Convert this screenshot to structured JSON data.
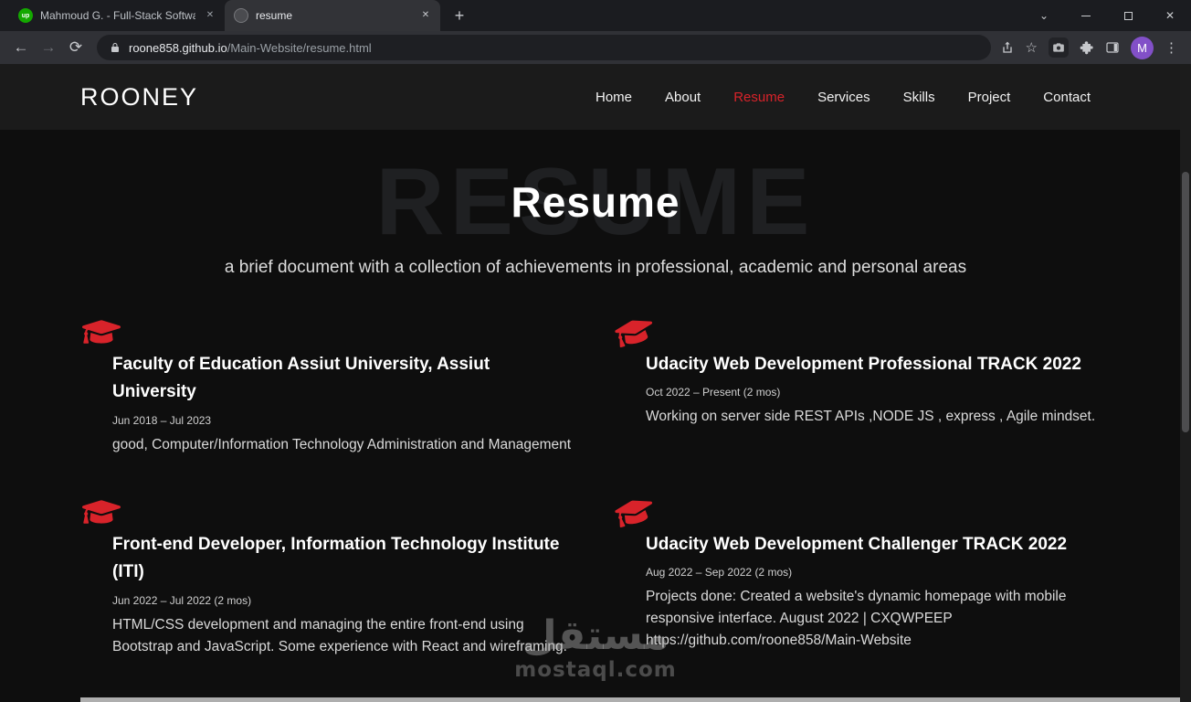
{
  "colors": {
    "accent-red": "#d8232a",
    "upwork-green": "#14a800",
    "avatar-purple": "#8250c8"
  },
  "browser": {
    "tabs": [
      {
        "title": "Mahmoud G. - Full-Stack Softwar",
        "favicon_text": "up"
      },
      {
        "title": "resume"
      }
    ],
    "url_host": "roone858.github.io",
    "url_path": "/Main-Website/resume.html",
    "avatar_letter": "M"
  },
  "icons": {
    "back": "←",
    "forward": "→",
    "reload": "⟳",
    "new_tab": "+",
    "tab_close": "✕",
    "window_chevron": "⌄",
    "window_close": "✕",
    "star": "☆",
    "kebab": "⋮"
  },
  "site": {
    "logo": "ROONEY",
    "nav": [
      {
        "label": "Home",
        "active": false
      },
      {
        "label": "About",
        "active": false
      },
      {
        "label": "Resume",
        "active": true
      },
      {
        "label": "Services",
        "active": false
      },
      {
        "label": "Skills",
        "active": false
      },
      {
        "label": "Project",
        "active": false
      },
      {
        "label": "Contact",
        "active": false
      }
    ]
  },
  "hero": {
    "bg_text": "RESUME",
    "title": "Resume",
    "subtitle": "a brief document with a collection of achievements in professional, academic and personal areas"
  },
  "resume_items": [
    {
      "title": "Faculty of Education Assiut University, Assiut University",
      "date": "Jun 2018 – Jul 2023",
      "description": "good, Computer/Information Technology Administration and Management"
    },
    {
      "title": "Udacity Web Development Professional TRACK 2022",
      "date": "Oct 2022 – Present (2 mos)",
      "description": "Working on server side REST APIs ,NODE JS , express , Agile mindset."
    },
    {
      "title": "Front-end Developer, Information Technology Institute (ITI)",
      "date": "Jun 2022 – Jul 2022 (2 mos)",
      "description": "HTML/CSS development and managing the entire front-end using Bootstrap and JavaScript. Some experience with React and wireframing."
    },
    {
      "title": "Udacity Web Development Challenger TRACK 2022",
      "date": "Aug 2022 – Sep 2022 (2 mos)",
      "description": "Projects done: Created a website's dynamic homepage with mobile responsive interface. August 2022 | CXQWPEEP https://github.com/roone858/Main-Website"
    }
  ],
  "watermark": {
    "arabic": "مستقل",
    "latin": "mostaql.com"
  }
}
